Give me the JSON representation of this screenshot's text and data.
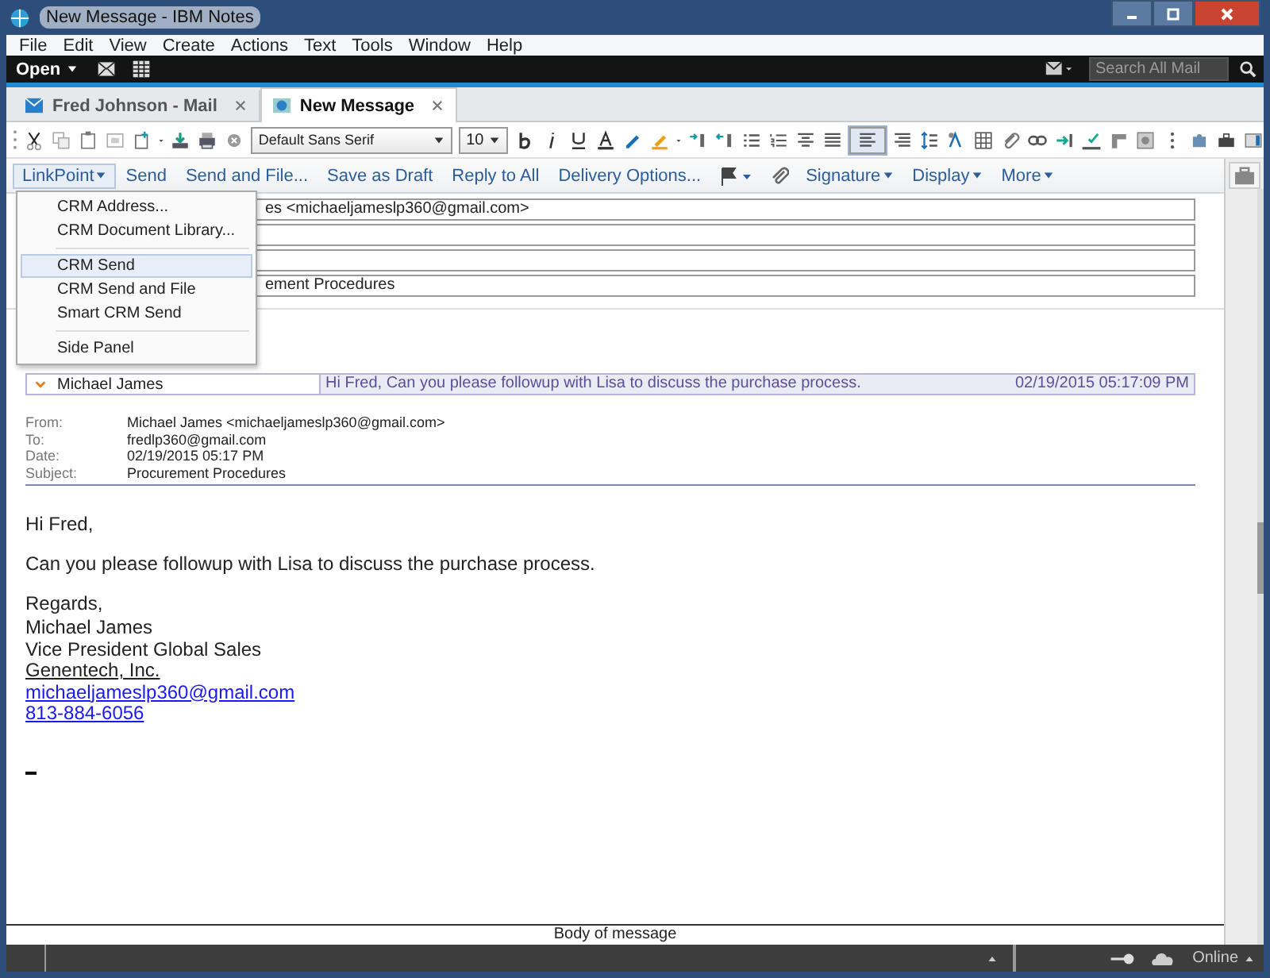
{
  "window": {
    "title": "New Message - IBM Notes"
  },
  "menu_bar": [
    "File",
    "Edit",
    "View",
    "Create",
    "Actions",
    "Text",
    "Tools",
    "Window",
    "Help"
  ],
  "nav_bar": {
    "open_label": "Open",
    "search": {
      "placeholder": "Search All Mail"
    }
  },
  "tabs": [
    {
      "label": "Fred Johnson - Mail",
      "selected": false,
      "kind": "mail"
    },
    {
      "label": "New Message",
      "selected": true,
      "kind": "memo"
    }
  ],
  "format_toolbar": {
    "font": "Default Sans Serif",
    "size": "10"
  },
  "action_bar": [
    {
      "label": "LinkPoint",
      "kind": "menu",
      "expanded": true
    },
    {
      "label": "Send",
      "kind": "button"
    },
    {
      "label": "Send and File...",
      "kind": "button"
    },
    {
      "label": "Save as Draft",
      "kind": "button"
    },
    {
      "label": "Reply to All",
      "kind": "button"
    },
    {
      "label": "Delivery Options...",
      "kind": "button"
    },
    {
      "kind": "flag"
    },
    {
      "kind": "attach"
    },
    {
      "label": "Signature",
      "kind": "menu",
      "expanded": false
    },
    {
      "label": "Display",
      "kind": "menu",
      "expanded": false
    },
    {
      "label": "More",
      "kind": "menu",
      "expanded": false
    }
  ],
  "linkpoint_menu": [
    {
      "label": "CRM Address...",
      "selected": false,
      "separator_before": false
    },
    {
      "label": "CRM Document Library...",
      "selected": false,
      "separator_before": false
    },
    {
      "label": "CRM Send",
      "selected": true,
      "separator_before": true
    },
    {
      "label": "CRM Send and File",
      "selected": false,
      "separator_before": false
    },
    {
      "label": "Smart CRM Send",
      "selected": false,
      "separator_before": false
    },
    {
      "label": "Side Panel",
      "selected": false,
      "separator_before": true
    }
  ],
  "address_fields": {
    "to": "es <michaeljameslp360@gmail.com>",
    "subject": "ement Procedures"
  },
  "quoted_message": {
    "sender": "Michael James",
    "snippet": "Hi Fred, Can you please followup with Lisa to discuss the purchase process.",
    "date": "02/19/2015 05:17:09 PM",
    "expanded": true
  },
  "headers": [
    {
      "label": "From:",
      "value": "Michael James <michaeljameslp360@gmail.com>"
    },
    {
      "label": "To:",
      "value": "fredlp360@gmail.com"
    },
    {
      "label": "Date:",
      "value": "02/19/2015 05:17 PM"
    },
    {
      "label": "Subject:",
      "value": "Procurement Procedures"
    }
  ],
  "body": {
    "greeting": "Hi Fred,",
    "paragraph": "Can you please followup with Lisa to discuss the purchase process.",
    "closing": "Regards,",
    "signature": [
      {
        "text": "Michael James",
        "kind": "plain"
      },
      {
        "text": "Vice President Global Sales",
        "kind": "plain"
      },
      {
        "text": "Genentech, Inc.",
        "kind": "underlined"
      },
      {
        "text": "michaeljameslp360@gmail.com",
        "kind": "link"
      },
      {
        "text": "813-884-6056",
        "kind": "link"
      }
    ]
  },
  "body_label": "Body of message",
  "status_bar": {
    "status": "Online"
  }
}
